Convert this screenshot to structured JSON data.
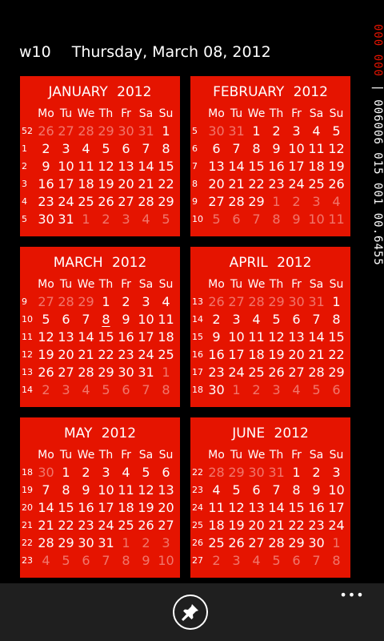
{
  "header": {
    "week": "w10",
    "date": "Thursday, March 08, 2012"
  },
  "tray": {
    "red": "000 000",
    "white": "| 006006 015 001 00.6455"
  },
  "dow": [
    "Mo",
    "Tu",
    "We",
    "Th",
    "Fr",
    "Sa",
    "Su"
  ],
  "months": [
    {
      "title": "JANUARY  2012",
      "weeks": [
        {
          "wk": "52",
          "days": [
            "26",
            "27",
            "28",
            "29",
            "30",
            "31",
            "1"
          ],
          "out": [
            1,
            1,
            1,
            1,
            1,
            1,
            0
          ]
        },
        {
          "wk": "1",
          "days": [
            "2",
            "3",
            "4",
            "5",
            "6",
            "7",
            "8"
          ],
          "out": [
            0,
            0,
            0,
            0,
            0,
            0,
            0
          ]
        },
        {
          "wk": "2",
          "days": [
            "9",
            "10",
            "11",
            "12",
            "13",
            "14",
            "15"
          ],
          "out": [
            0,
            0,
            0,
            0,
            0,
            0,
            0
          ]
        },
        {
          "wk": "3",
          "days": [
            "16",
            "17",
            "18",
            "19",
            "20",
            "21",
            "22"
          ],
          "out": [
            0,
            0,
            0,
            0,
            0,
            0,
            0
          ]
        },
        {
          "wk": "4",
          "days": [
            "23",
            "24",
            "25",
            "26",
            "27",
            "28",
            "29"
          ],
          "out": [
            0,
            0,
            0,
            0,
            0,
            0,
            0
          ]
        },
        {
          "wk": "5",
          "days": [
            "30",
            "31",
            "1",
            "2",
            "3",
            "4",
            "5"
          ],
          "out": [
            0,
            0,
            1,
            1,
            1,
            1,
            1
          ]
        }
      ]
    },
    {
      "title": "FEBRUARY  2012",
      "weeks": [
        {
          "wk": "5",
          "days": [
            "30",
            "31",
            "1",
            "2",
            "3",
            "4",
            "5"
          ],
          "out": [
            1,
            1,
            0,
            0,
            0,
            0,
            0
          ]
        },
        {
          "wk": "6",
          "days": [
            "6",
            "7",
            "8",
            "9",
            "10",
            "11",
            "12"
          ],
          "out": [
            0,
            0,
            0,
            0,
            0,
            0,
            0
          ]
        },
        {
          "wk": "7",
          "days": [
            "13",
            "14",
            "15",
            "16",
            "17",
            "18",
            "19"
          ],
          "out": [
            0,
            0,
            0,
            0,
            0,
            0,
            0
          ]
        },
        {
          "wk": "8",
          "days": [
            "20",
            "21",
            "22",
            "23",
            "24",
            "25",
            "26"
          ],
          "out": [
            0,
            0,
            0,
            0,
            0,
            0,
            0
          ]
        },
        {
          "wk": "9",
          "days": [
            "27",
            "28",
            "29",
            "1",
            "2",
            "3",
            "4"
          ],
          "out": [
            0,
            0,
            0,
            1,
            1,
            1,
            1
          ]
        },
        {
          "wk": "10",
          "days": [
            "5",
            "6",
            "7",
            "8",
            "9",
            "10",
            "11"
          ],
          "out": [
            1,
            1,
            1,
            1,
            1,
            1,
            1
          ]
        }
      ]
    },
    {
      "title": "MARCH  2012",
      "weeks": [
        {
          "wk": "9",
          "days": [
            "27",
            "28",
            "29",
            "1",
            "2",
            "3",
            "4"
          ],
          "out": [
            1,
            1,
            1,
            0,
            0,
            0,
            0
          ]
        },
        {
          "wk": "10",
          "days": [
            "5",
            "6",
            "7",
            "8",
            "9",
            "10",
            "11"
          ],
          "out": [
            0,
            0,
            0,
            0,
            0,
            0,
            0
          ],
          "today": 3
        },
        {
          "wk": "11",
          "days": [
            "12",
            "13",
            "14",
            "15",
            "16",
            "17",
            "18"
          ],
          "out": [
            0,
            0,
            0,
            0,
            0,
            0,
            0
          ]
        },
        {
          "wk": "12",
          "days": [
            "19",
            "20",
            "21",
            "22",
            "23",
            "24",
            "25"
          ],
          "out": [
            0,
            0,
            0,
            0,
            0,
            0,
            0
          ]
        },
        {
          "wk": "13",
          "days": [
            "26",
            "27",
            "28",
            "29",
            "30",
            "31",
            "1"
          ],
          "out": [
            0,
            0,
            0,
            0,
            0,
            0,
            1
          ]
        },
        {
          "wk": "14",
          "days": [
            "2",
            "3",
            "4",
            "5",
            "6",
            "7",
            "8"
          ],
          "out": [
            1,
            1,
            1,
            1,
            1,
            1,
            1
          ]
        }
      ]
    },
    {
      "title": "APRIL  2012",
      "weeks": [
        {
          "wk": "13",
          "days": [
            "26",
            "27",
            "28",
            "29",
            "30",
            "31",
            "1"
          ],
          "out": [
            1,
            1,
            1,
            1,
            1,
            1,
            0
          ]
        },
        {
          "wk": "14",
          "days": [
            "2",
            "3",
            "4",
            "5",
            "6",
            "7",
            "8"
          ],
          "out": [
            0,
            0,
            0,
            0,
            0,
            0,
            0
          ]
        },
        {
          "wk": "15",
          "days": [
            "9",
            "10",
            "11",
            "12",
            "13",
            "14",
            "15"
          ],
          "out": [
            0,
            0,
            0,
            0,
            0,
            0,
            0
          ]
        },
        {
          "wk": "16",
          "days": [
            "16",
            "17",
            "18",
            "19",
            "20",
            "21",
            "22"
          ],
          "out": [
            0,
            0,
            0,
            0,
            0,
            0,
            0
          ]
        },
        {
          "wk": "17",
          "days": [
            "23",
            "24",
            "25",
            "26",
            "27",
            "28",
            "29"
          ],
          "out": [
            0,
            0,
            0,
            0,
            0,
            0,
            0
          ]
        },
        {
          "wk": "18",
          "days": [
            "30",
            "1",
            "2",
            "3",
            "4",
            "5",
            "6"
          ],
          "out": [
            0,
            1,
            1,
            1,
            1,
            1,
            1
          ]
        }
      ]
    },
    {
      "title": "MAY  2012",
      "weeks": [
        {
          "wk": "18",
          "days": [
            "30",
            "1",
            "2",
            "3",
            "4",
            "5",
            "6"
          ],
          "out": [
            1,
            0,
            0,
            0,
            0,
            0,
            0
          ]
        },
        {
          "wk": "19",
          "days": [
            "7",
            "8",
            "9",
            "10",
            "11",
            "12",
            "13"
          ],
          "out": [
            0,
            0,
            0,
            0,
            0,
            0,
            0
          ]
        },
        {
          "wk": "20",
          "days": [
            "14",
            "15",
            "16",
            "17",
            "18",
            "19",
            "20"
          ],
          "out": [
            0,
            0,
            0,
            0,
            0,
            0,
            0
          ]
        },
        {
          "wk": "21",
          "days": [
            "21",
            "22",
            "23",
            "24",
            "25",
            "26",
            "27"
          ],
          "out": [
            0,
            0,
            0,
            0,
            0,
            0,
            0
          ]
        },
        {
          "wk": "22",
          "days": [
            "28",
            "29",
            "30",
            "31",
            "1",
            "2",
            "3"
          ],
          "out": [
            0,
            0,
            0,
            0,
            1,
            1,
            1
          ]
        },
        {
          "wk": "23",
          "days": [
            "4",
            "5",
            "6",
            "7",
            "8",
            "9",
            "10"
          ],
          "out": [
            1,
            1,
            1,
            1,
            1,
            1,
            1
          ]
        }
      ]
    },
    {
      "title": "JUNE  2012",
      "weeks": [
        {
          "wk": "22",
          "days": [
            "28",
            "29",
            "30",
            "31",
            "1",
            "2",
            "3"
          ],
          "out": [
            1,
            1,
            1,
            1,
            0,
            0,
            0
          ]
        },
        {
          "wk": "23",
          "days": [
            "4",
            "5",
            "6",
            "7",
            "8",
            "9",
            "10"
          ],
          "out": [
            0,
            0,
            0,
            0,
            0,
            0,
            0
          ]
        },
        {
          "wk": "24",
          "days": [
            "11",
            "12",
            "13",
            "14",
            "15",
            "16",
            "17"
          ],
          "out": [
            0,
            0,
            0,
            0,
            0,
            0,
            0
          ]
        },
        {
          "wk": "25",
          "days": [
            "18",
            "19",
            "20",
            "21",
            "22",
            "23",
            "24"
          ],
          "out": [
            0,
            0,
            0,
            0,
            0,
            0,
            0
          ]
        },
        {
          "wk": "26",
          "days": [
            "25",
            "26",
            "27",
            "28",
            "29",
            "30",
            "1"
          ],
          "out": [
            0,
            0,
            0,
            0,
            0,
            0,
            1
          ]
        },
        {
          "wk": "27",
          "days": [
            "2",
            "3",
            "4",
            "5",
            "6",
            "7",
            "8"
          ],
          "out": [
            1,
            1,
            1,
            1,
            1,
            1,
            1
          ]
        }
      ]
    }
  ],
  "appbar": {
    "pin_icon": "pin-icon",
    "more": "•••"
  },
  "colors": {
    "accent": "#e51400",
    "background": "#000000",
    "appbar": "#1f1f1f"
  }
}
